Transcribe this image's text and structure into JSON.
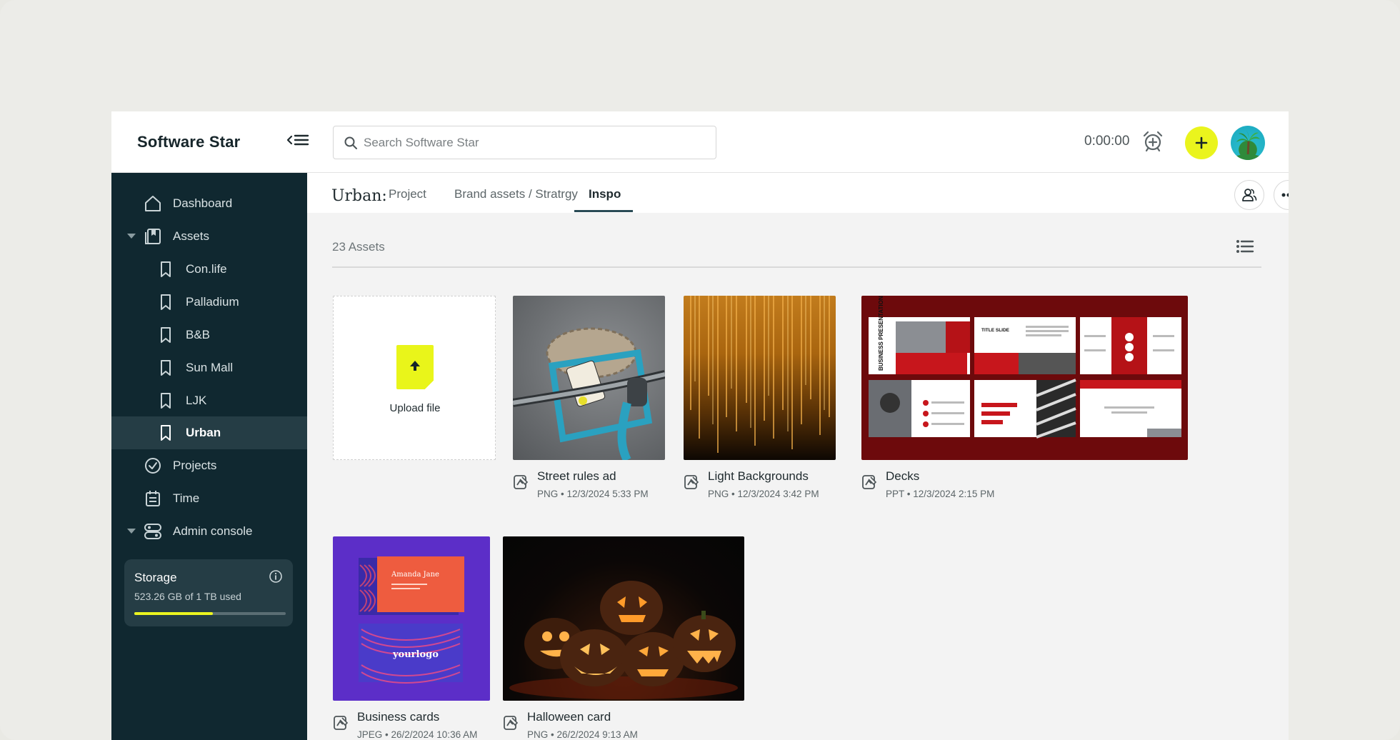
{
  "app": {
    "brand": "Software Star"
  },
  "search": {
    "placeholder": "Search Software Star"
  },
  "timer": {
    "value": "0:00:00"
  },
  "sidebar": {
    "items": [
      {
        "label": "Dashboard"
      },
      {
        "label": "Assets"
      },
      {
        "label": "Con.life"
      },
      {
        "label": "Palladium"
      },
      {
        "label": "B&B"
      },
      {
        "label": "Sun Mall"
      },
      {
        "label": "LJK"
      },
      {
        "label": "Urban"
      },
      {
        "label": "Projects"
      },
      {
        "label": "Time"
      },
      {
        "label": "Admin console"
      }
    ],
    "storage": {
      "title": "Storage",
      "usage": "523.26 GB of 1 TB used",
      "used_fraction": 0.52
    }
  },
  "header": {
    "title": "Urban:",
    "tabs": [
      {
        "label": "Project"
      },
      {
        "label": "Brand assets / Stratrgy"
      },
      {
        "label": "Inspo"
      }
    ],
    "active_tab": "Inspo"
  },
  "content": {
    "count": "23 Assets",
    "upload_label": "Upload file",
    "assets": [
      {
        "name": "Street rules ad",
        "meta": "PNG • 12/3/2024 5:33 PM"
      },
      {
        "name": "Light Backgrounds",
        "meta": "PNG • 12/3/2024 3:42 PM"
      },
      {
        "name": "Decks",
        "meta": "PPT • 12/3/2024 2:15 PM"
      },
      {
        "name": "Business cards",
        "meta": "JPEG • 26/2/2024 10:36 AM"
      },
      {
        "name": "Halloween card",
        "meta": "PNG • 26/2/2024 9:13 AM"
      }
    ],
    "deck_text": {
      "vertical": "BUSINESS PRESENTATION",
      "slide_title": "TITLE SLIDE"
    },
    "card_text": {
      "name": "Amanda Jane",
      "logo": "yourlogo"
    }
  },
  "colors": {
    "accent": "#eaf41d",
    "sidebar": "#102830",
    "sidebar_active": "#253d45"
  }
}
